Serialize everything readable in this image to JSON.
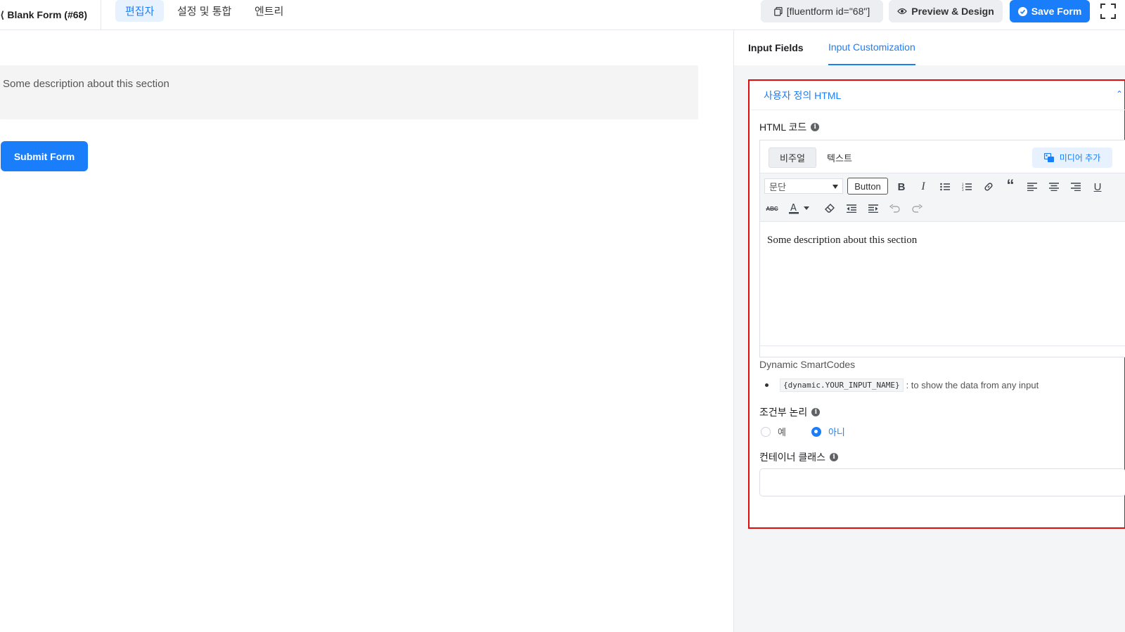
{
  "header": {
    "form_title": "Blank Form (#68)",
    "tabs": [
      {
        "label": "편집자",
        "active": true
      },
      {
        "label": "설정 및 통합",
        "active": false
      },
      {
        "label": "엔트리",
        "active": false
      }
    ],
    "shortcode_label": "[fluentform id=\"68\"]",
    "preview_label": "Preview & Design",
    "save_label": "Save Form"
  },
  "canvas": {
    "description": "Some description about this section",
    "submit_label": "Submit Form"
  },
  "panel": {
    "tabs": [
      {
        "label": "Input Fields",
        "active": false
      },
      {
        "label": "Input Customization",
        "active": true
      }
    ],
    "section_title": "사용자 정의 HTML",
    "html_code_label": "HTML 코드",
    "editor": {
      "visual_tab": "비주얼",
      "text_tab": "텍스트",
      "add_media": "미디어 추가",
      "format_select": "문단",
      "button_label": "Button",
      "content": "Some description about this section"
    },
    "smartcodes": {
      "title": "Dynamic SmartCodes",
      "code": "{dynamic.YOUR_INPUT_NAME}",
      "desc": ": to show the data from any input"
    },
    "conditional_label": "조건부 논리",
    "radio_yes": "예",
    "radio_no": "아니",
    "radio_selected": "아니",
    "container_class_label": "컨테이너 클래스",
    "container_class_value": ""
  },
  "colors": {
    "accent": "#1a7efb",
    "highlight_border": "#e00b0b"
  }
}
